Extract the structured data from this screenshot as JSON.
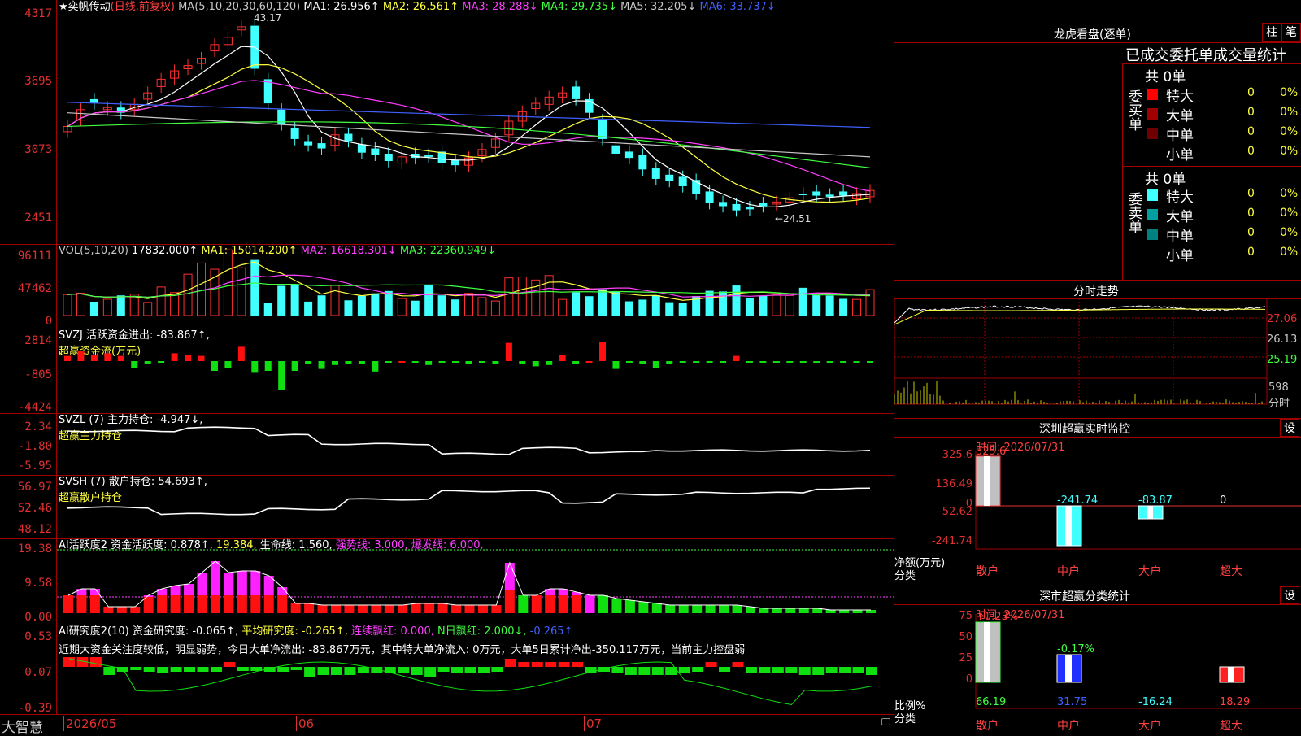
{
  "app": {
    "name": "大智慧"
  },
  "chart": {
    "title": "★奕帆传动",
    "period": "(日线,前复权)",
    "ma_hdr": "MA(5,10,20,30,60,120)",
    "ma1": "MA1: 26.956↑",
    "ma2": "MA2: 26.561↑",
    "ma3": "MA3: 28.288↓",
    "ma4": "MA4: 29.735↓",
    "ma5": "MA5: 32.205↓",
    "ma6": "MA6: 33.737↓",
    "hi_label": "43.17",
    "lo_label": "←24.51",
    "y_ticks": [
      "4317",
      "3695",
      "3073",
      "2451"
    ]
  },
  "vol": {
    "hdr": "VOL(5,10,20)",
    "val": "17832.000↑",
    "ma1": "MA1: 15014.200↑",
    "ma2": "MA2: 16618.301↓",
    "ma3": "MA3: 22360.949↓",
    "y_ticks": [
      "96111",
      "47462",
      "0"
    ]
  },
  "svzj": {
    "hdr": "SVZJ  活跃资金进出: -83.867↑,",
    "sub": "超赢资金流(万元)",
    "y_ticks": [
      "2814",
      "-805",
      "-4424"
    ]
  },
  "svzl": {
    "hdr": "SVZL (7) 主力持仓: -4.947↓,",
    "sub": "超赢主力持仓",
    "y_ticks": [
      "2.34",
      "-1.80",
      "-5.95"
    ]
  },
  "svsh": {
    "hdr": "SVSH (7) 散户持仓: 54.693↑,",
    "sub": "超赢散户持仓",
    "y_ticks": [
      "56.97",
      "52.46",
      "48.12"
    ]
  },
  "ai1": {
    "hdr": "AI活跃度2 资金活跃度: 0.878↑,",
    "v2": "19.384,",
    "life": "生命线: 1.560,",
    "strong": "强势线: 3.000,",
    "burst": "爆发线: 6.000,",
    "y_ticks": [
      "19.38",
      "9.58",
      "0.00"
    ]
  },
  "ai2": {
    "hdr": "AI研究度2(10) 资金研究度: -0.065↑,",
    "avg": "平均研究度: -0.265↑,",
    "cont": "连续飘红: 0.000,",
    "nday": "N日飘红: 2.000↓,",
    "neg": "-0.265↑",
    "note": "近期大资金关注度较低，明显弱势，今日大单净流出: -83.867万元，其中特大单净流入: 0万元，大单5日累计净出-350.117万元，当前主力控盘弱",
    "y_ticks": [
      "0.53",
      "0.07",
      "-0.39"
    ]
  },
  "x_axis": {
    "labels": [
      "2026/05",
      "06",
      "07"
    ]
  },
  "dragon": {
    "title": "龙虎看盘(逐单)",
    "btn1": "柱",
    "btn2": "笔",
    "tabs": "已成交委托单成交量统计",
    "buy_total": "共 0单",
    "sell_total": "共 0单",
    "buy_label": "委买单",
    "sell_label": "委卖单",
    "rows": [
      {
        "name": "特大",
        "n": "0",
        "p": "0%"
      },
      {
        "name": "大单",
        "n": "0",
        "p": "0%"
      },
      {
        "name": "中单",
        "n": "0",
        "p": "0%"
      },
      {
        "name": "小单",
        "n": "0",
        "p": "0%"
      }
    ],
    "colors": {
      "buy": [
        "#ff0000",
        "#a00000",
        "#700000",
        "#000000"
      ],
      "sell": [
        "#40ffff",
        "#00a0a0",
        "#008080",
        "#000000"
      ]
    }
  },
  "intraday": {
    "title": "分时走势",
    "y_ticks": [
      "27.06",
      "26.13",
      "25.19"
    ],
    "vol_ticks": [
      "598",
      "分时"
    ]
  },
  "sz_monitor": {
    "title": "深圳超赢实时监控",
    "btn": "设",
    "time": "时间: 2026/07/31",
    "y_ticks": [
      "325.6",
      "136.49",
      "0",
      "-52.62",
      "-241.74"
    ],
    "ylabel": "净额(万元)",
    "xlabel": "分类",
    "bars": [
      {
        "label": "散户",
        "value": "325.6"
      },
      {
        "label": "中户",
        "value": "-241.74"
      },
      {
        "label": "大户",
        "value": "-83.87"
      },
      {
        "label": "超大",
        "value": "0"
      }
    ]
  },
  "sz_class": {
    "title": "深市超赢分类统计",
    "btn": "设",
    "time": "时间: 2026/07/31",
    "y_ticks": [
      "75",
      "50",
      "25",
      "0"
    ],
    "ylabel": "比例%",
    "xlabel": "分类",
    "bars": [
      {
        "label": "散户",
        "value": "66.19",
        "delta": "+0.23%"
      },
      {
        "label": "中户",
        "value": "31.75",
        "delta": "-0.17%"
      },
      {
        "label": "大户",
        "value": "-16.24",
        "delta": ""
      },
      {
        "label": "超大",
        "value": "18.29",
        "delta": ""
      }
    ]
  }
}
